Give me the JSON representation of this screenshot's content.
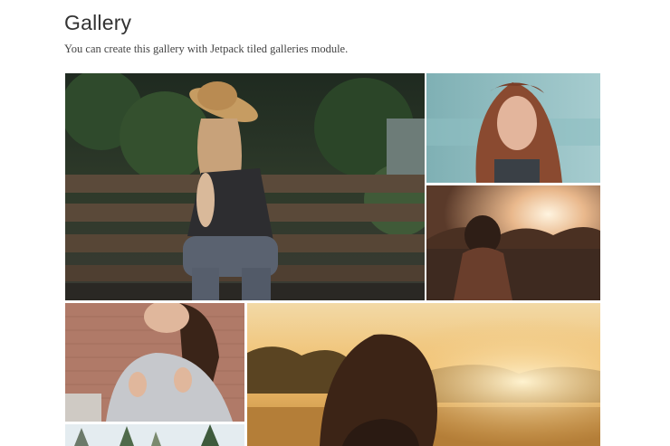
{
  "page": {
    "title": "Gallery",
    "description": "You can create this gallery with Jetpack tiled galleries module."
  },
  "gallery": {
    "images": [
      {
        "subject": "woman-straw-hat-on-bench"
      },
      {
        "subject": "woman-red-hair-portrait"
      },
      {
        "subject": "person-at-sunset"
      },
      {
        "subject": "woman-grey-sweater-brick-wall"
      },
      {
        "subject": "woman-golden-hour-field"
      },
      {
        "subject": "trees-partial"
      }
    ]
  }
}
